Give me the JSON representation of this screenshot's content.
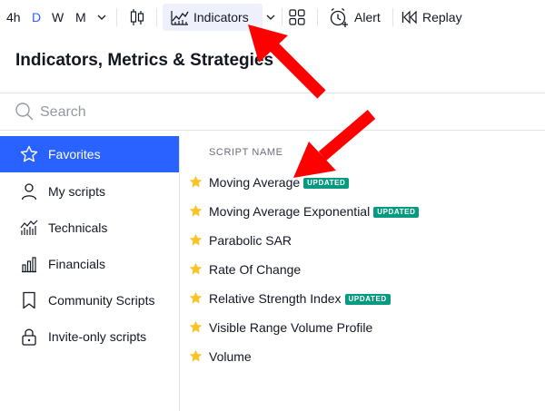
{
  "toolbar": {
    "intervals": [
      {
        "label": "4h"
      },
      {
        "label": "D"
      },
      {
        "label": "W"
      },
      {
        "label": "M"
      }
    ],
    "indicators_label": "Indicators",
    "alert_label": "Alert",
    "replay_label": "Replay"
  },
  "dialog": {
    "title": "Indicators, Metrics & Strategies",
    "search_placeholder": "Search"
  },
  "sidebar": {
    "items": [
      {
        "label": "Favorites",
        "icon": "star-outline-icon",
        "active": true
      },
      {
        "label": "My scripts",
        "icon": "user-icon"
      },
      {
        "label": "Technicals",
        "icon": "technicals-chart-icon"
      },
      {
        "label": "Financials",
        "icon": "bar-chart-icon"
      },
      {
        "label": "Community Scripts",
        "icon": "bookmark-icon"
      },
      {
        "label": "Invite-only scripts",
        "icon": "lock-icon"
      }
    ]
  },
  "list": {
    "column_header": "SCRIPT NAME",
    "items": [
      {
        "name": "Moving Average",
        "badge": "UPDATED"
      },
      {
        "name": "Moving Average Exponential",
        "badge": "UPDATED"
      },
      {
        "name": "Parabolic SAR"
      },
      {
        "name": "Rate Of Change"
      },
      {
        "name": "Relative Strength Index",
        "badge": "UPDATED"
      },
      {
        "name": "Visible Range Volume Profile"
      },
      {
        "name": "Volume"
      }
    ]
  },
  "colors": {
    "accent": "#2962ff",
    "badge": "#089981",
    "star": "#f7c525",
    "annotation_arrow": "#ff0000"
  }
}
